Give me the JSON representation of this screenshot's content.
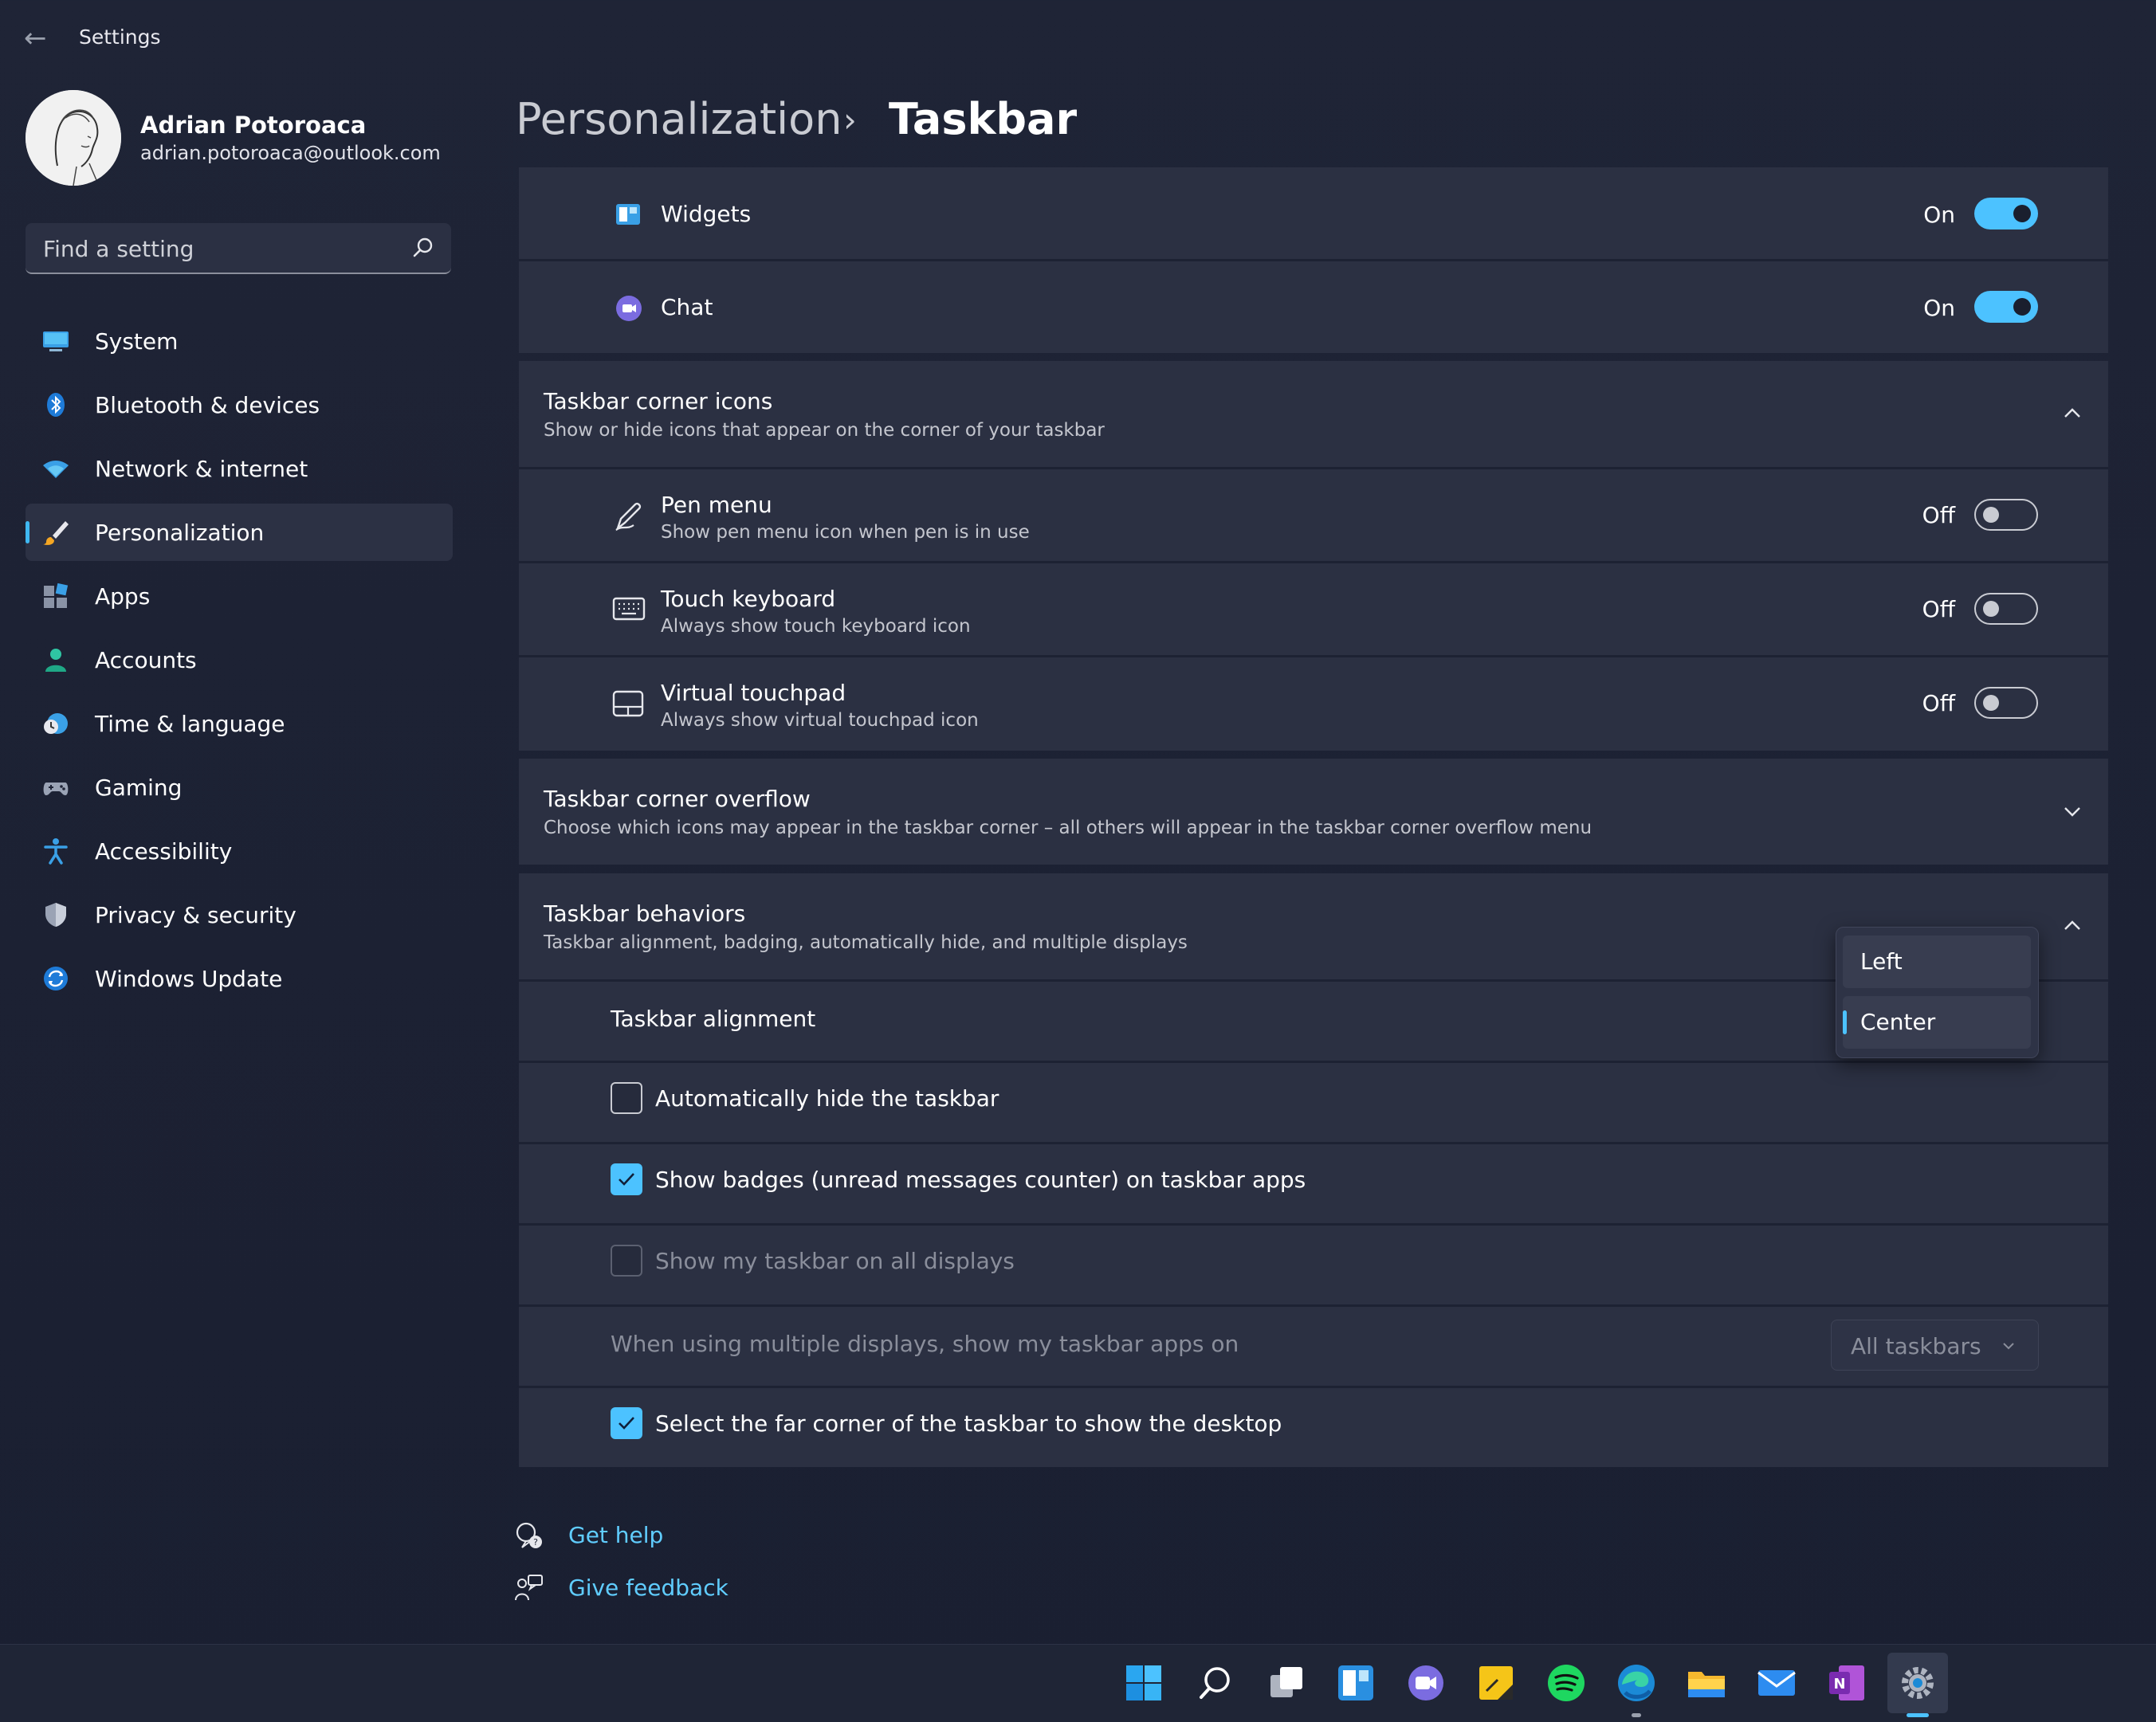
{
  "window": {
    "title": "Settings"
  },
  "user": {
    "name": "Adrian Potoroaca",
    "email": "adrian.potoroaca@outlook.com"
  },
  "search": {
    "placeholder": "Find a setting"
  },
  "nav": [
    {
      "label": "System",
      "icon": "monitor-icon"
    },
    {
      "label": "Bluetooth & devices",
      "icon": "bluetooth-icon"
    },
    {
      "label": "Network & internet",
      "icon": "wifi-icon"
    },
    {
      "label": "Personalization",
      "icon": "brush-icon",
      "active": true
    },
    {
      "label": "Apps",
      "icon": "apps-icon"
    },
    {
      "label": "Accounts",
      "icon": "person-icon"
    },
    {
      "label": "Time & language",
      "icon": "clock-globe-icon"
    },
    {
      "label": "Gaming",
      "icon": "gamepad-icon"
    },
    {
      "label": "Accessibility",
      "icon": "accessibility-icon"
    },
    {
      "label": "Privacy & security",
      "icon": "shield-icon"
    },
    {
      "label": "Windows Update",
      "icon": "update-icon"
    }
  ],
  "header": {
    "section": "Personalization",
    "separator": "›",
    "page": "Taskbar"
  },
  "taskbar_items": {
    "widgets": {
      "label": "Widgets",
      "state": "On"
    },
    "chat": {
      "label": "Chat",
      "state": "On"
    }
  },
  "corner_icons": {
    "title": "Taskbar corner icons",
    "subtitle": "Show or hide icons that appear on the corner of your taskbar",
    "items": [
      {
        "label": "Pen menu",
        "desc": "Show pen menu icon when pen is in use",
        "state": "Off"
      },
      {
        "label": "Touch keyboard",
        "desc": "Always show touch keyboard icon",
        "state": "Off"
      },
      {
        "label": "Virtual touchpad",
        "desc": "Always show virtual touchpad icon",
        "state": "Off"
      }
    ]
  },
  "corner_overflow": {
    "title": "Taskbar corner overflow",
    "subtitle": "Choose which icons may appear in the taskbar corner – all others will appear in the taskbar corner overflow menu"
  },
  "behaviors": {
    "title": "Taskbar behaviors",
    "subtitle": "Taskbar alignment, badging, automatically hide, and multiple displays",
    "alignment_label": "Taskbar alignment",
    "alignment_options": [
      "Left",
      "Center"
    ],
    "alignment_selected": "Center",
    "autohide": {
      "label": "Automatically hide the taskbar",
      "checked": false
    },
    "badges": {
      "label": "Show badges (unread messages counter) on taskbar apps",
      "checked": true
    },
    "all_displays": {
      "label": "Show my taskbar on all displays",
      "checked": false,
      "disabled": true
    },
    "multi_display": {
      "label": "When using multiple displays, show my taskbar apps on",
      "value": "All taskbars"
    },
    "far_corner": {
      "label": "Select the far corner of the taskbar to show the desktop",
      "checked": true
    }
  },
  "help": {
    "get_help": "Get help",
    "feedback": "Give feedback"
  },
  "colors": {
    "accent": "#4cc2ff",
    "link": "#60cdff",
    "background": "#1f2436",
    "card": "#2b3042"
  }
}
